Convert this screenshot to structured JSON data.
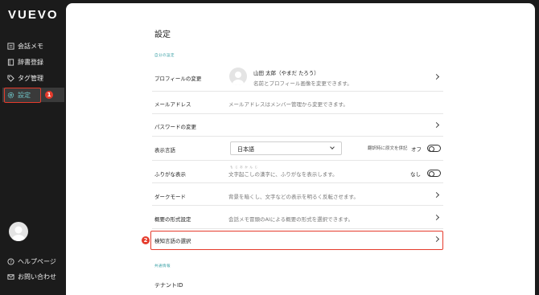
{
  "app": {
    "logo": "VUEVO"
  },
  "sidebar": {
    "items": [
      {
        "label": "会話メモ",
        "icon": "memo-icon"
      },
      {
        "label": "辞書登録",
        "icon": "book-icon"
      },
      {
        "label": "タグ管理",
        "icon": "tag-icon"
      },
      {
        "label": "設定",
        "icon": "gear-icon"
      }
    ],
    "bottom": [
      {
        "label": "ヘルプページ",
        "icon": "help-icon"
      },
      {
        "label": "お問い合わせ",
        "icon": "mail-icon"
      }
    ]
  },
  "badges": {
    "first": "1",
    "second": "2"
  },
  "page": {
    "title": "設定",
    "section_personal": "自分の設定",
    "section_common": "共通情報"
  },
  "rows": {
    "profile": {
      "label": "プロフィールの変更",
      "name": "山田 太郎（やまだ たろう）",
      "desc": "名前とプロフィール画像を変更できます。"
    },
    "email": {
      "label": "メールアドレス",
      "desc": "メールアドレスはメンバー管理から変更できます。"
    },
    "password": {
      "label": "パスワードの変更"
    },
    "language": {
      "label": "表示言語",
      "selected": "日本語",
      "translation_label": "翻訳時に原文を併記",
      "translation_state": "オフ"
    },
    "furigana": {
      "label": "ふりがな表示",
      "desc": "文字起こしの漢字に、ふりがなを表示します。",
      "ruby": "もじおかんじ",
      "state": "なし"
    },
    "darkmode": {
      "label": "ダークモード",
      "desc": "背景を暗くし、文字などの表示を明るく反転させます。"
    },
    "summary": {
      "label": "概要の形式設定",
      "desc": "会話メモ冒頭のAIによる概要の形式を選択できます。"
    },
    "detect_lang": {
      "label": "検知言語の選択"
    },
    "tenant": {
      "label": "テナントID"
    }
  }
}
